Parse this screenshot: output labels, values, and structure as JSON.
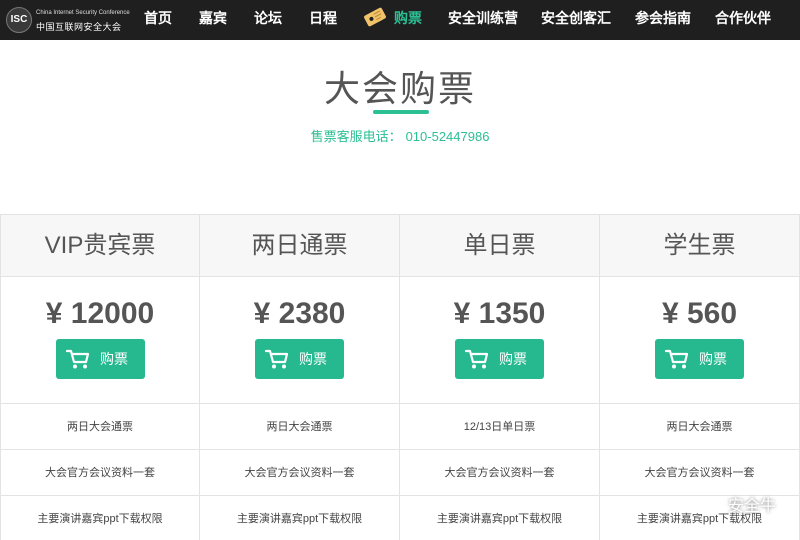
{
  "brand": {
    "badge": "ISC",
    "en_name": "China Internet Security Conference",
    "cn_name": "中国互联网安全大会"
  },
  "nav": {
    "items": [
      "首页",
      "嘉宾",
      "论坛",
      "日程",
      "购票",
      "安全训练营",
      "安全创客汇",
      "参会指南",
      "合作伙伴"
    ],
    "active": "购票"
  },
  "page": {
    "title": "大会购票",
    "hotline_label": "售票客服电话：",
    "hotline_number": "010-52447986"
  },
  "tickets": [
    {
      "name": "VIP贵宾票",
      "price": "¥ 12000",
      "buy_label": "购票",
      "features": [
        "两日大会通票",
        "大会官方会议资料一套",
        "主要演讲嘉宾ppt下载权限"
      ]
    },
    {
      "name": "两日通票",
      "price": "¥ 2380",
      "buy_label": "购票",
      "features": [
        "两日大会通票",
        "大会官方会议资料一套",
        "主要演讲嘉宾ppt下载权限"
      ]
    },
    {
      "name": "单日票",
      "price": "¥ 1350",
      "buy_label": "购票",
      "features": [
        "12/13日单日票",
        "大会官方会议资料一套",
        "主要演讲嘉宾ppt下载权限"
      ]
    },
    {
      "name": "学生票",
      "price": "¥ 560",
      "buy_label": "购票",
      "features": [
        "两日大会通票",
        "大会官方会议资料一套",
        "主要演讲嘉宾ppt下载权限"
      ]
    }
  ],
  "watermark": {
    "text": "安全牛"
  },
  "colors": {
    "accent": "#2bbf93",
    "button": "#26b88f",
    "nav_bg": "#1f1f1f"
  }
}
